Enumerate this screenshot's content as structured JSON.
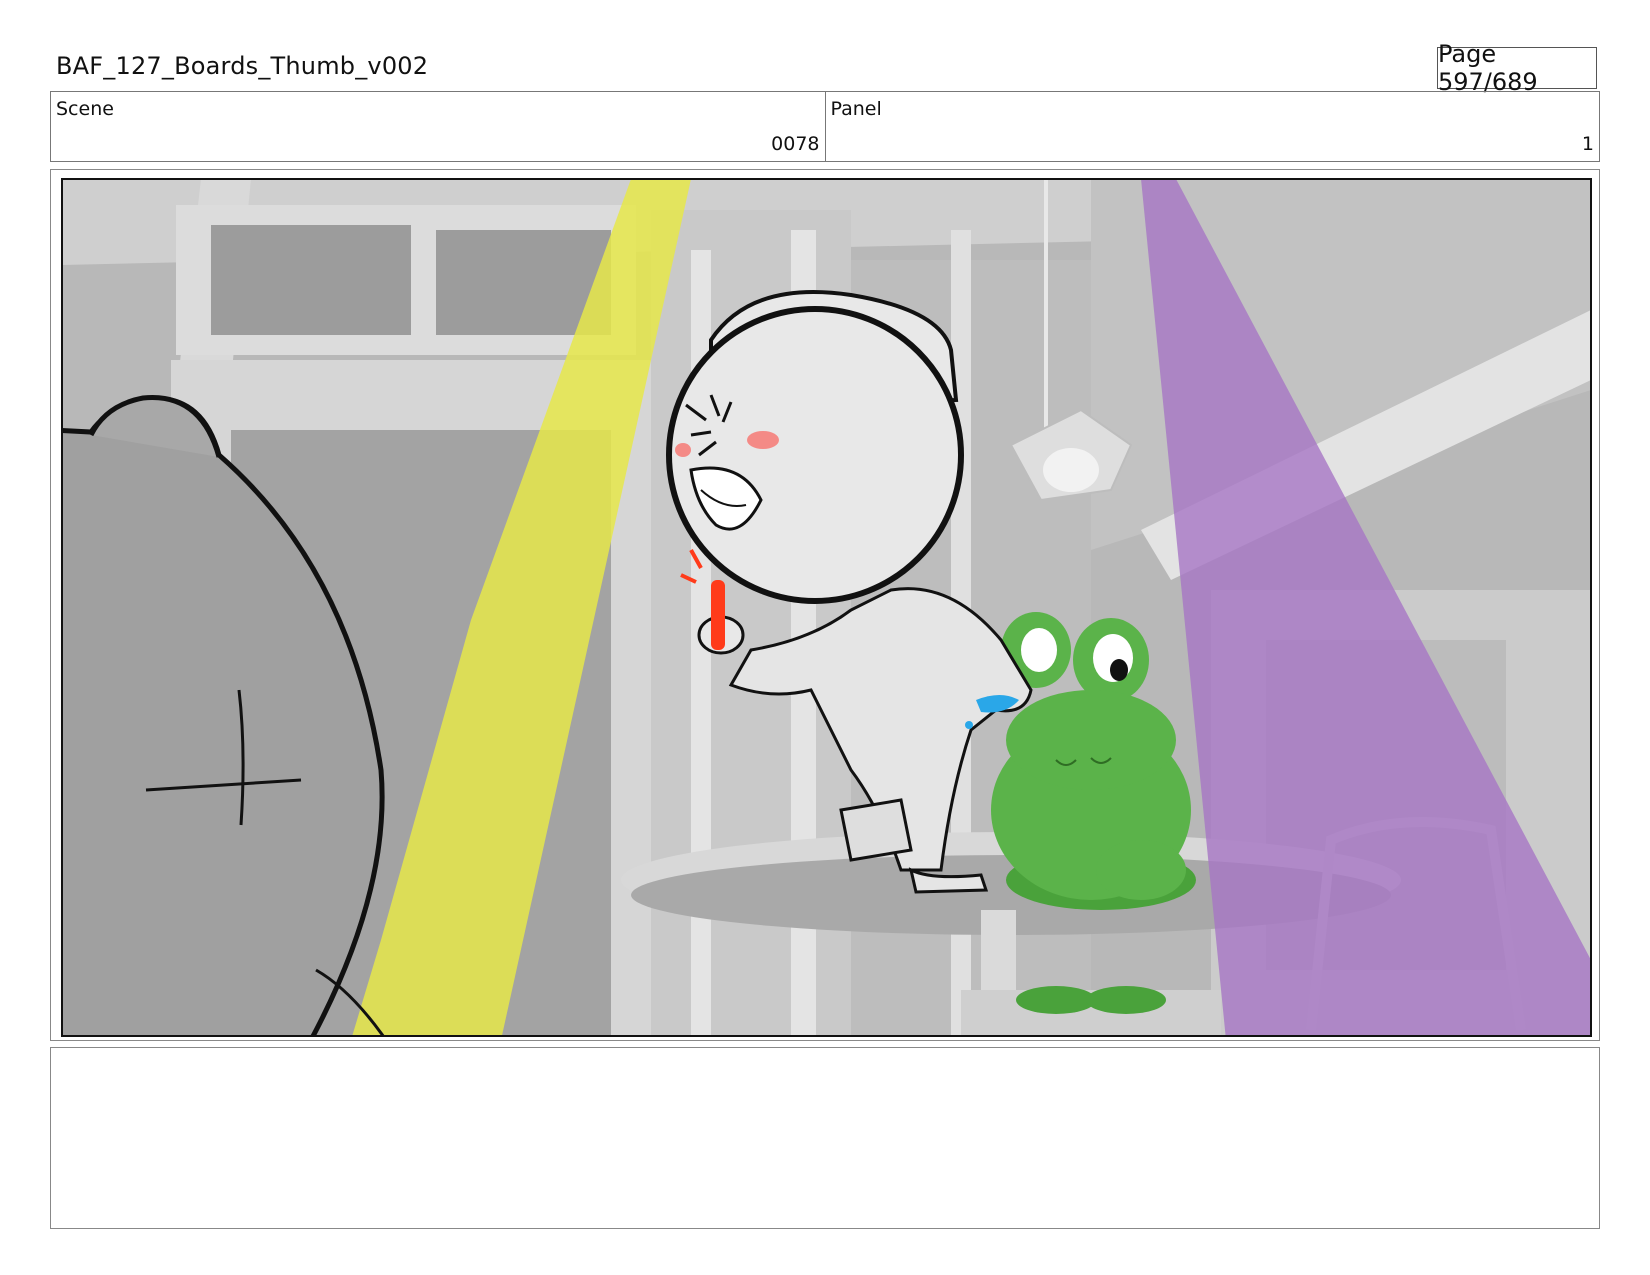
{
  "header": {
    "title": "BAF_127_Boards_Thumb_v002",
    "page_label": "Page 597/689"
  },
  "scene": {
    "label": "Scene",
    "value": "0078"
  },
  "panel": {
    "label": "Panel",
    "value": "1"
  },
  "notes": {
    "text": ""
  },
  "artwork": {
    "description_icons": [
      "storyboard-panel-image"
    ],
    "colors": {
      "yellow_beam": "#e6e84a",
      "purple_beam": "#a676c4",
      "frog": "#5bb34a",
      "blush": "#f48a86",
      "marker": "#ff3b1a",
      "water": "#2aa7e8"
    }
  }
}
